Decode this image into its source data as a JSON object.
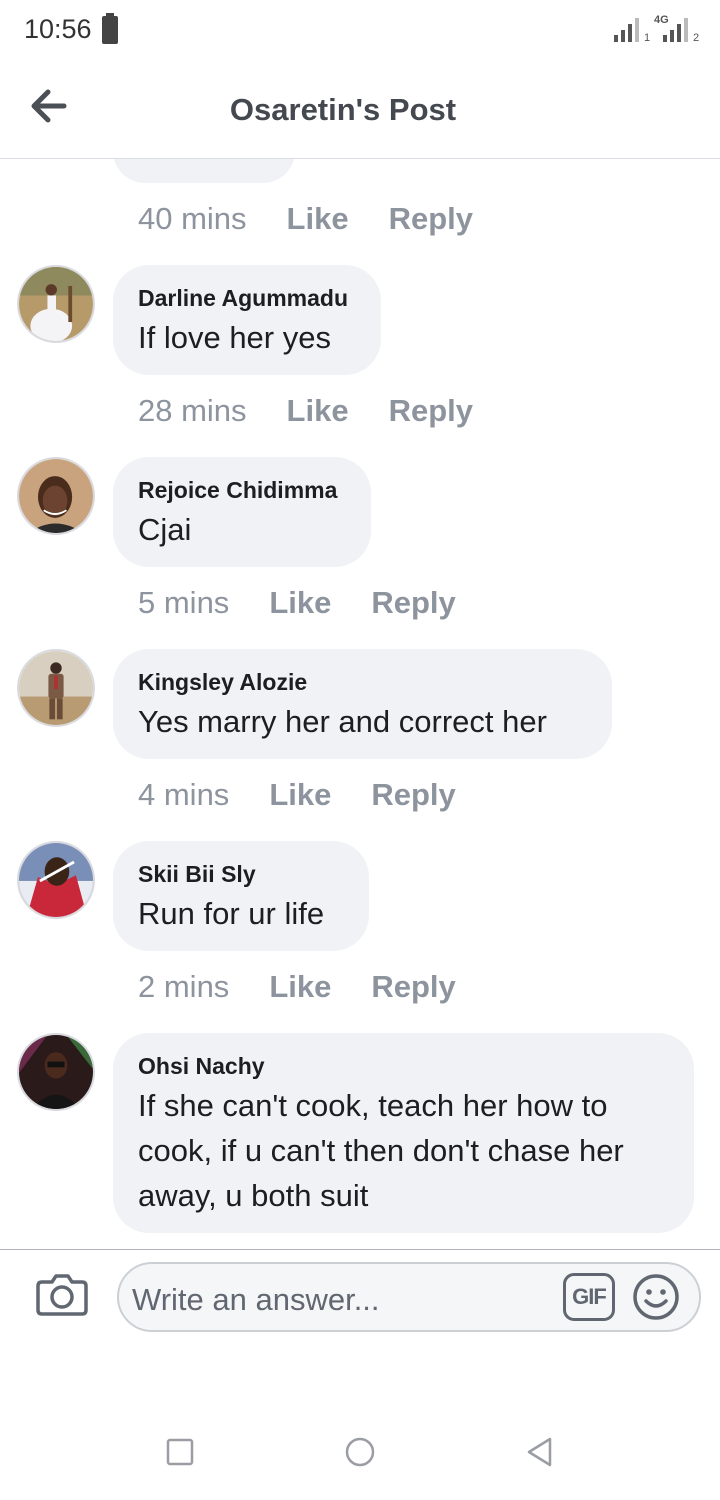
{
  "status_bar": {
    "time": "10:56",
    "network": "4G"
  },
  "header": {
    "title": "Osaretin's Post",
    "back_icon": "back-arrow-icon"
  },
  "actions": {
    "like_label": "Like",
    "reply_label": "Reply"
  },
  "previous_comment": {
    "time": "40 mins"
  },
  "comments": [
    {
      "author": "Darline Agummadu",
      "text": "If love her yes",
      "time": "28 mins",
      "avatar": "bride-in-white-dress"
    },
    {
      "author": "Rejoice Chidimma",
      "text": "Cjai",
      "time": "5 mins",
      "avatar": "woman-portrait"
    },
    {
      "author": "Kingsley Alozie",
      "text": "Yes marry her and correct her",
      "time": "4 mins",
      "avatar": "man-in-suit"
    },
    {
      "author": "Skii Bii Sly",
      "text": "Run for ur life",
      "time": "2 mins",
      "avatar": "man-red-jacket"
    },
    {
      "author": "Ohsi Nachy",
      "text": "If she can't cook, teach her how to cook, if u can't then don't chase her away, u both suit",
      "avatar": "man-dark-background"
    }
  ],
  "composer": {
    "placeholder": "Write an answer...",
    "gif_label": "GIF"
  },
  "colors": {
    "bubble": "#f0f2f5",
    "meta_text": "#8d949e",
    "title": "#444950"
  }
}
